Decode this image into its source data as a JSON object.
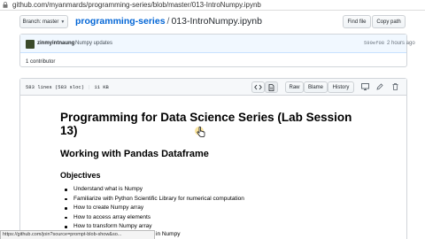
{
  "browser": {
    "url": "github.com/myanmards/programming-series/blob/master/013-IntroNumpy.ipynb"
  },
  "repo_header": {
    "branch_label": "Branch: master",
    "repo_name": "programming-series",
    "separator": "/",
    "file_name": "013-IntroNumpy.ipynb",
    "find_file_label": "Find file",
    "copy_path_label": "Copy path"
  },
  "commit": {
    "author": "zinmyintnaung",
    "message": "Numpy updates",
    "sha": "599ef08",
    "time": "2 hours ago",
    "contributors": "1 contributor"
  },
  "file": {
    "lines": "583 lines (583 sloc)",
    "size": "11 KB",
    "raw_label": "Raw",
    "blame_label": "Blame",
    "history_label": "History"
  },
  "notebook": {
    "title": "Programming for Data Science Series (Lab Session 13)",
    "subtitle": "Working with Pandas Dataframe",
    "objectives_heading": "Objectives",
    "objectives": [
      "Understand what is Numpy",
      "Familiarize with Python Scientific Library for numerical computation",
      "How to create Numpy array",
      "How to access array elements",
      "How to transform Numpy array"
    ],
    "partial_line_tail": "in Numpy"
  },
  "status_bar": {
    "text": "https://github.com/join?source=prompt-blob-show&so..."
  },
  "colors": {
    "link": "#0366d6",
    "commit_bg": "#f1f8ff",
    "header_bg": "#f6f8fa",
    "border": "#d1d5da"
  },
  "icons": {
    "lock": "lock-icon",
    "code": "code-icon",
    "document": "document-icon",
    "desktop": "desktop-icon",
    "pencil": "pencil-icon",
    "trash": "trash-icon",
    "cursor": "hand-cursor-icon"
  }
}
